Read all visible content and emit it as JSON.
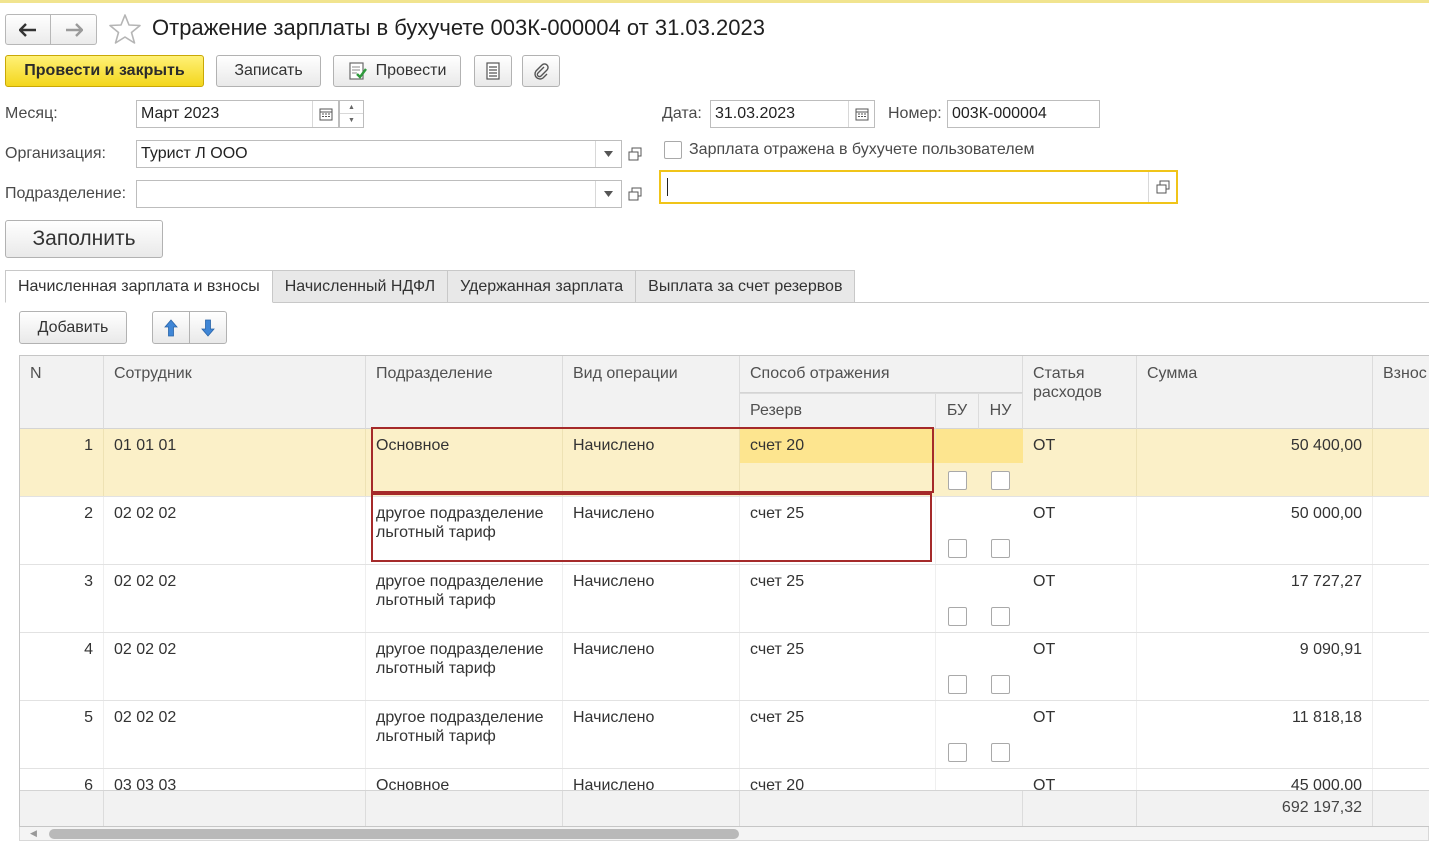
{
  "window": {
    "title": "Отражение зарплаты в бухучете 003К-000004 от 31.03.2023",
    "back_icon": "arrow-left-icon",
    "forward_icon": "arrow-right-icon",
    "favorite_icon": "star-icon"
  },
  "toolbar": {
    "post_and_close": "Провести и закрыть",
    "save": "Записать",
    "post": "Провести"
  },
  "form": {
    "month_label": "Месяц:",
    "month_value": "Март 2023",
    "date_label": "Дата:",
    "date_value": "31.03.2023",
    "number_label": "Номер:",
    "number_value": "003К-000004",
    "org_label": "Организация:",
    "org_value": "Турист Л ООО",
    "dept_label": "Подразделение:",
    "dept_value": "",
    "checkbox_label": "Зарплата отражена в бухучете пользователем",
    "checkbox_checked": false,
    "comment_value": "",
    "fill_button": "Заполнить"
  },
  "tabs": [
    {
      "label": "Начисленная зарплата и взносы",
      "active": true
    },
    {
      "label": "Начисленный НДФЛ",
      "active": false
    },
    {
      "label": "Удержанная зарплата",
      "active": false
    },
    {
      "label": "Выплата за счет резервов",
      "active": false
    }
  ],
  "table_toolbar": {
    "add": "Добавить"
  },
  "table": {
    "headers": {
      "n": "N",
      "employee": "Сотрудник",
      "department": "Подразделение",
      "operation": "Вид операции",
      "method": "Способ отражения",
      "reserve": "Резерв",
      "bu": "БУ",
      "nu": "НУ",
      "expense_line1": "Статья",
      "expense_line2": "расходов",
      "amount": "Сумма",
      "contrib": "Взнос"
    },
    "rows": [
      {
        "n": "1",
        "employee": "01 01 01",
        "dept1": "Основное",
        "dept2": "",
        "operation": "Начислено",
        "method": "счет 20",
        "bu": false,
        "nu": false,
        "expense": "ОТ",
        "amount": "50 400,00"
      },
      {
        "n": "2",
        "employee": "02 02 02",
        "dept1": "другое подразделение",
        "dept2": "льготный тариф",
        "operation": "Начислено",
        "method": "счет 25",
        "bu": false,
        "nu": false,
        "expense": "ОТ",
        "amount": "50 000,00"
      },
      {
        "n": "3",
        "employee": "02 02 02",
        "dept1": "другое подразделение",
        "dept2": "льготный тариф",
        "operation": "Начислено",
        "method": "счет 25",
        "bu": false,
        "nu": false,
        "expense": "ОТ",
        "amount": "17 727,27"
      },
      {
        "n": "4",
        "employee": "02 02 02",
        "dept1": "другое подразделение",
        "dept2": "льготный тариф",
        "operation": "Начислено",
        "method": "счет 25",
        "bu": false,
        "nu": false,
        "expense": "ОТ",
        "amount": "9 090,91"
      },
      {
        "n": "5",
        "employee": "02 02 02",
        "dept1": "другое подразделение",
        "dept2": "льготный тариф",
        "operation": "Начислено",
        "method": "счет 25",
        "bu": false,
        "nu": false,
        "expense": "ОТ",
        "amount": "11 818,18"
      },
      {
        "n": "6",
        "employee": "03 03 03",
        "dept1": "Основное",
        "dept2": "",
        "operation": "Начислено",
        "method": "счет 20",
        "bu": false,
        "nu": false,
        "expense": "ОТ",
        "amount": "45 000,00"
      }
    ],
    "total": "692 197,32",
    "selected_row": 1
  },
  "colors": {
    "primary_button": "#f3d61c",
    "selected_row": "#fbf0c8",
    "selected_cell": "#fde58f",
    "highlight_outline": "#a52a2a",
    "focused_field_border": "#f0c419"
  }
}
